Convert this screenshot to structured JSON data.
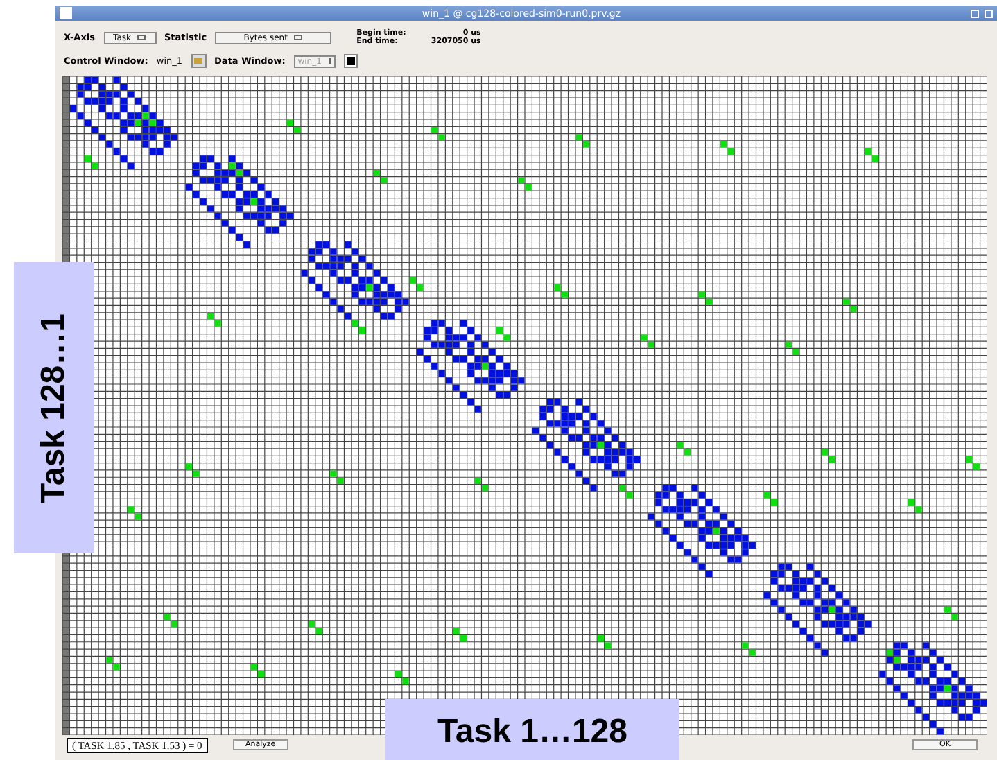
{
  "window": {
    "title": "win_1 @ cg128-colored-sim0-run0.prv.gz"
  },
  "controls": {
    "x_axis": {
      "label": "X-Axis",
      "value": "Task"
    },
    "statistic": {
      "label": "Statistic",
      "value": "Bytes sent"
    },
    "begin_time": {
      "label": "Begin time:",
      "value": "0 us"
    },
    "end_time": {
      "label": "End time:",
      "value": "3207050 us"
    },
    "control_window": {
      "label": "Control Window:",
      "value": "win_1"
    },
    "data_window": {
      "label": "Data Window:",
      "value": "win_1",
      "disabled": true
    }
  },
  "tooltip": "( TASK 1.85 , TASK 1.53 ) = 0",
  "buttons": [
    "Analyze",
    "OK"
  ],
  "overlay_labels": {
    "y": "Task 128…1",
    "x": "Task 1…128"
  }
}
